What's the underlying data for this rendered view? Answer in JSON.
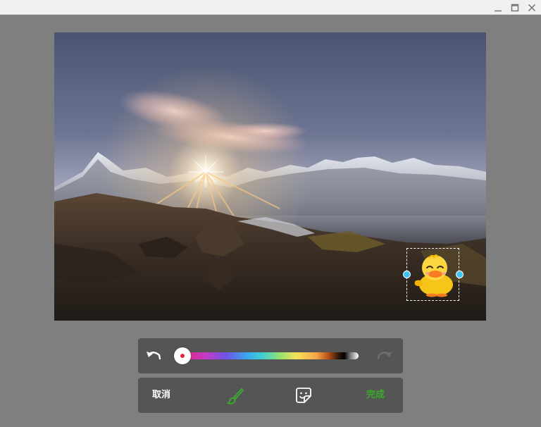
{
  "window": {
    "controls": [
      {
        "name": "minimize",
        "icon": "minimize-icon"
      },
      {
        "name": "maximize",
        "icon": "maximize-icon"
      },
      {
        "name": "close",
        "icon": "close-icon"
      }
    ]
  },
  "canvas": {
    "image": "mountain-sunset-photo",
    "sticker": {
      "icon": "duck-sticker-icon",
      "selected": true
    }
  },
  "color_bar": {
    "undo_icon": "undo-icon",
    "redo_icon": "redo-icon",
    "redo_enabled": false,
    "selected_color": "#e8213a",
    "slider_position": 0.0
  },
  "action_bar": {
    "cancel_label": "取消",
    "done_label": "完成",
    "brush_icon": "brush-icon",
    "sticker_icon": "sticker-icon",
    "active_tool": "brush"
  },
  "colors": {
    "accent": "#3aab2b",
    "toolbar_bg": "#555555",
    "workspace_bg": "#7f7f7f",
    "handle": "#3cc3f0"
  }
}
